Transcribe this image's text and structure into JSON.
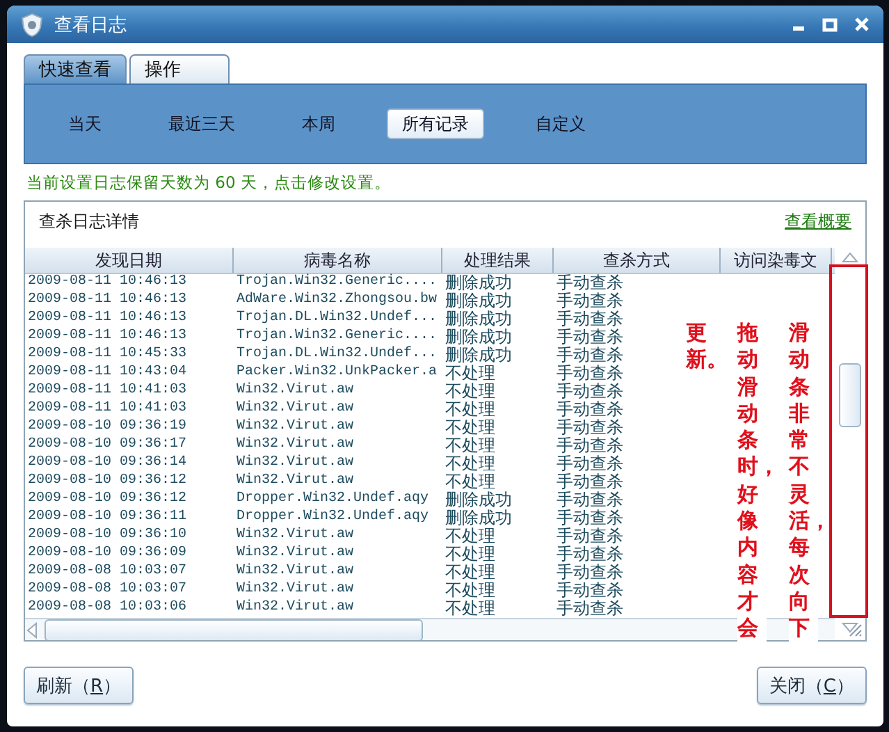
{
  "window": {
    "title": "查看日志"
  },
  "tabs": [
    {
      "label": "快速查看",
      "selected": true
    },
    {
      "label": "操作",
      "selected": false
    }
  ],
  "filters": [
    {
      "label": "当天",
      "selected": false
    },
    {
      "label": "最近三天",
      "selected": false
    },
    {
      "label": "本周",
      "selected": false
    },
    {
      "label": "所有记录",
      "selected": true
    },
    {
      "label": "自定义",
      "selected": false
    }
  ],
  "retention_notice": "当前设置日志保留天数为 60 天，点击修改设置。",
  "log_panel": {
    "title": "查杀日志详情",
    "summary_link": "查看概要",
    "columns": [
      "发现日期",
      "病毒名称",
      "处理结果",
      "查杀方式",
      "访问染毒文"
    ],
    "rows": [
      [
        "2009-08-11 10:46:13",
        "Trojan.Win32.Generic....",
        "删除成功",
        "手动查杀"
      ],
      [
        "2009-08-11 10:46:13",
        "AdWare.Win32.Zhongsou.bw",
        "删除成功",
        "手动查杀"
      ],
      [
        "2009-08-11 10:46:13",
        "Trojan.DL.Win32.Undef...",
        "删除成功",
        "手动查杀"
      ],
      [
        "2009-08-11 10:46:13",
        "Trojan.Win32.Generic....",
        "删除成功",
        "手动查杀"
      ],
      [
        "2009-08-11 10:45:33",
        "Trojan.DL.Win32.Undef...",
        "删除成功",
        "手动查杀"
      ],
      [
        "2009-08-11 10:43:04",
        "Packer.Win32.UnkPacker.a",
        "不处理",
        "手动查杀"
      ],
      [
        "2009-08-11 10:41:03",
        "Win32.Virut.aw",
        "不处理",
        "手动查杀"
      ],
      [
        "2009-08-11 10:41:03",
        "Win32.Virut.aw",
        "不处理",
        "手动查杀"
      ],
      [
        "2009-08-10 09:36:19",
        "Win32.Virut.aw",
        "不处理",
        "手动查杀"
      ],
      [
        "2009-08-10 09:36:17",
        "Win32.Virut.aw",
        "不处理",
        "手动查杀"
      ],
      [
        "2009-08-10 09:36:14",
        "Win32.Virut.aw",
        "不处理",
        "手动查杀"
      ],
      [
        "2009-08-10 09:36:12",
        "Win32.Virut.aw",
        "不处理",
        "手动查杀"
      ],
      [
        "2009-08-10 09:36:12",
        "Dropper.Win32.Undef.aqy",
        "删除成功",
        "手动查杀"
      ],
      [
        "2009-08-10 09:36:11",
        "Dropper.Win32.Undef.aqy",
        "删除成功",
        "手动查杀"
      ],
      [
        "2009-08-10 09:36:10",
        "Win32.Virut.aw",
        "不处理",
        "手动查杀"
      ],
      [
        "2009-08-10 09:36:09",
        "Win32.Virut.aw",
        "不处理",
        "手动查杀"
      ],
      [
        "2009-08-08 10:03:07",
        "Win32.Virut.aw",
        "不处理",
        "手动查杀"
      ],
      [
        "2009-08-08 10:03:07",
        "Win32.Virut.aw",
        "不处理",
        "手动查杀"
      ],
      [
        "2009-08-08 10:03:06",
        "Win32.Virut.aw",
        "不处理",
        "手动查杀"
      ]
    ]
  },
  "annotation": {
    "columns": [
      "更新。",
      "拖动滑动条时，好像内容才会",
      "滑动条非常不灵活，每次向下"
    ]
  },
  "buttons": [
    {
      "kind": "left",
      "prefix": "刷新（",
      "accel": "R",
      "suffix": "）"
    },
    {
      "kind": "right",
      "prefix": "关闭（",
      "accel": "C",
      "suffix": "）"
    }
  ]
}
